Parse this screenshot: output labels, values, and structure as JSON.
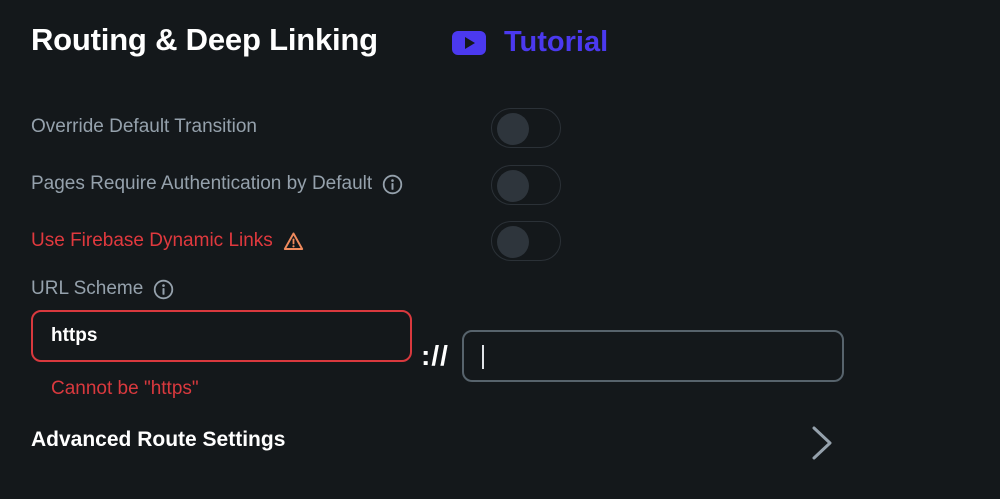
{
  "header": {
    "title": "Routing & Deep Linking",
    "tutorial_label": "Tutorial",
    "tutorial_icon": "youtube-play-icon"
  },
  "settings": {
    "override_transition": {
      "label": "Override Default Transition",
      "enabled": false
    },
    "require_auth": {
      "label": "Pages Require Authentication by Default",
      "enabled": false,
      "icon": "info-icon"
    },
    "firebase_links": {
      "label": "Use Firebase Dynamic Links",
      "enabled": false,
      "icon": "warning-icon"
    }
  },
  "url_scheme": {
    "label": "URL Scheme",
    "icon": "info-icon",
    "scheme_value": "https",
    "separator": "://",
    "host_value": "",
    "error": "Cannot be \"https\""
  },
  "advanced": {
    "label": "Advanced Route Settings",
    "icon": "chevron-right-icon"
  },
  "colors": {
    "background": "#14181b",
    "accent": "#4b39ef",
    "error": "#e0393e",
    "secondary_text": "#95a1ac"
  }
}
